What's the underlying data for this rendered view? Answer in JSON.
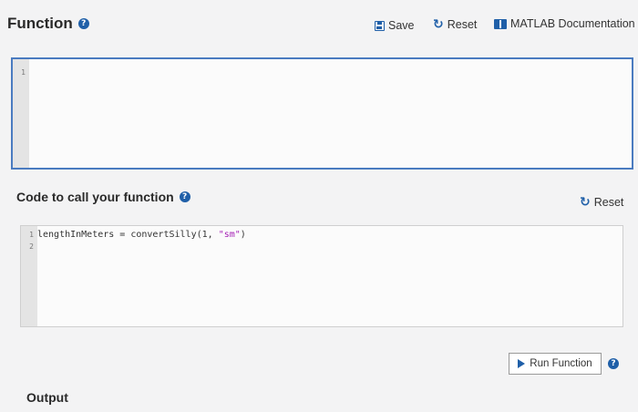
{
  "header": {
    "title": "Function",
    "save_label": "Save",
    "reset_label": "Reset",
    "docs_label": "MATLAB Documentation"
  },
  "function_editor": {
    "line_numbers": [
      "1"
    ]
  },
  "call_section": {
    "title": "Code to call your function",
    "reset_label": "Reset",
    "line_numbers": [
      "1",
      "2"
    ],
    "code_line_1_pre": "lengthInMeters = convertSilly(1, ",
    "code_line_1_string": "\"sm\"",
    "code_line_1_post": ")"
  },
  "run_button": {
    "label": "Run Function"
  },
  "output": {
    "title": "Output"
  },
  "icons": {
    "help": "question-circle-icon",
    "save": "floppy-disk-icon",
    "reset": "reset-arrow-icon",
    "docs": "book-icon",
    "run": "play-icon"
  },
  "colors": {
    "accent": "#1f5fa8",
    "editor_border": "#4a7bc0",
    "string": "#a41fb5"
  }
}
